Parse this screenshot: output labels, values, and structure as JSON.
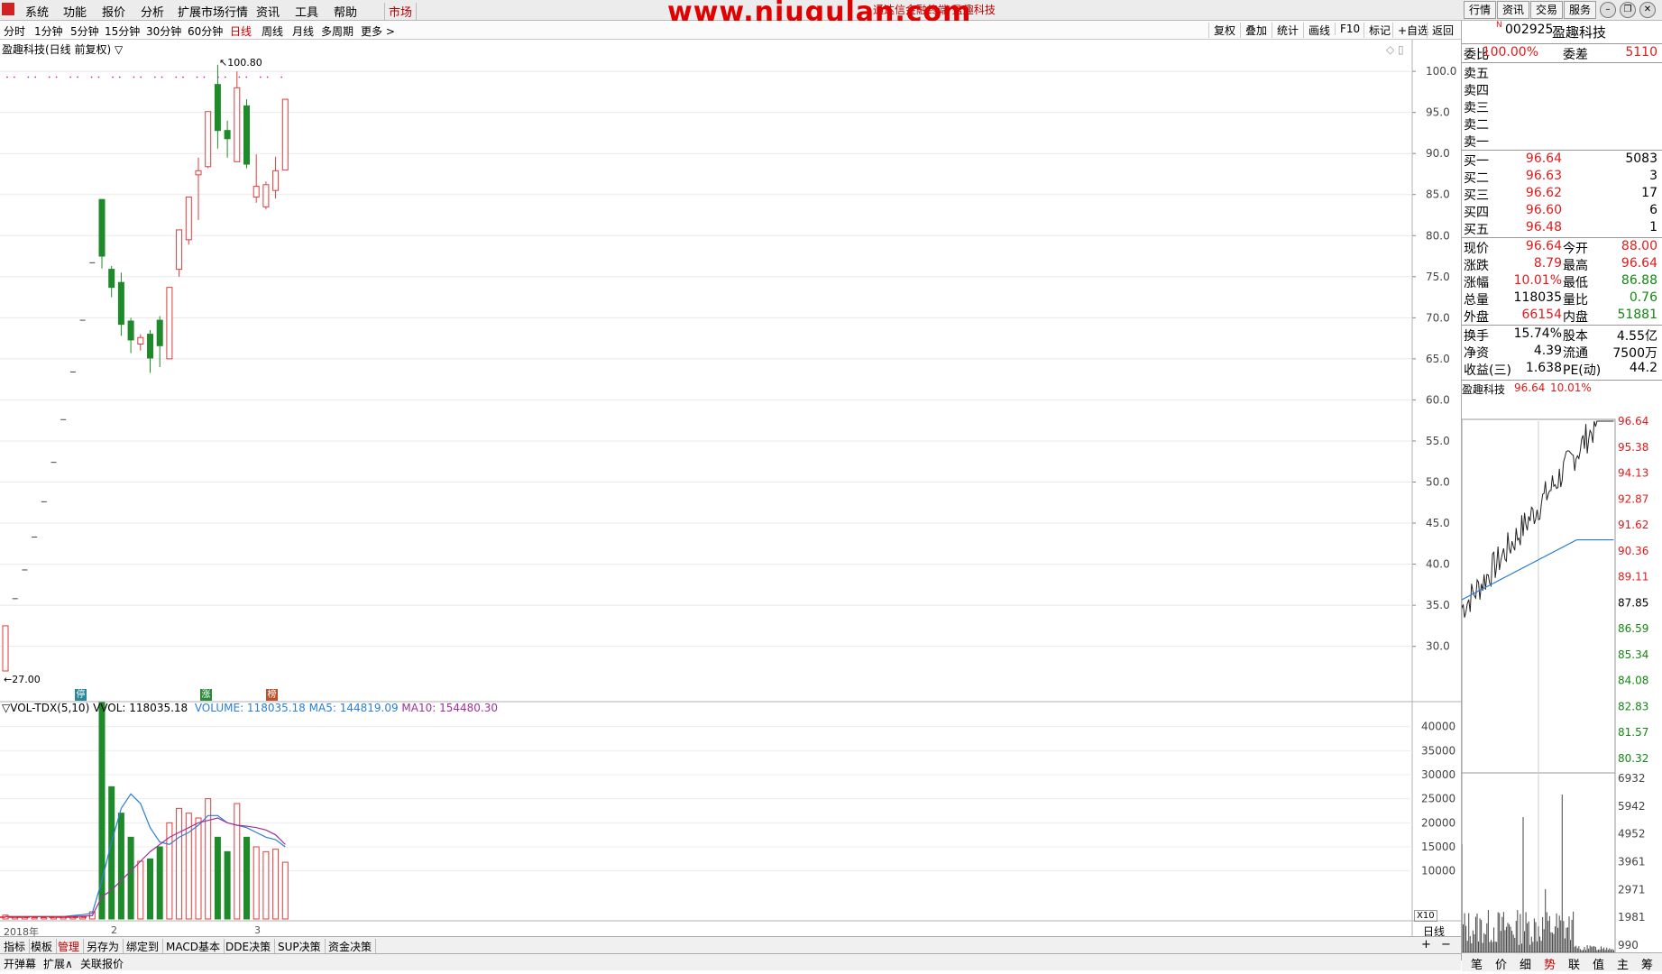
{
  "menu": {
    "items": [
      "系统",
      "功能",
      "报价",
      "分析",
      "扩展市场行情",
      "资讯",
      "工具",
      "帮助"
    ],
    "active": "市场",
    "watermark": "www.niugulan.com",
    "window_title": "通达信金融终端 盈趣科技",
    "right_buttons": [
      "行情",
      "资讯",
      "交易",
      "服务"
    ]
  },
  "periods": {
    "items": [
      "分时",
      "1分钟",
      "5分钟",
      "15分钟",
      "30分钟",
      "60分钟",
      "日线",
      "周线",
      "月线",
      "多周期",
      "更多 >"
    ],
    "active": "日线",
    "tools": [
      "复权",
      "叠加",
      "统计",
      "画线",
      "F10",
      "标记",
      "+自选",
      "返回"
    ]
  },
  "chart": {
    "title": "盈趣科技(日线 前复权) ▽",
    "high_label": "100.80",
    "low_label": "27.00",
    "markers": [
      "停",
      "涨",
      "榜"
    ],
    "x_labels": [
      "2018年",
      "2",
      "3"
    ],
    "period_label": "日线",
    "vol_title_prefix": "▽VOL-TDX(5,10)",
    "vol_value": "VVOL: 118035.18",
    "volume_label": "VOLUME: 118035.18",
    "ma5_label": "MA5: 144819.09",
    "ma10_label": "MA10: 154480.30",
    "x10": "X10"
  },
  "chart_data": {
    "type": "candlestick",
    "price_axis": {
      "ticks": [
        100.0,
        95.0,
        90.0,
        85.0,
        80.0,
        75.0,
        70.0,
        65.0,
        60.0,
        55.0,
        50.0,
        45.0,
        40.0,
        35.0,
        30.0
      ],
      "range": [
        27,
        101
      ]
    },
    "volume_axis": {
      "ticks": [
        40000,
        35000,
        30000,
        25000,
        20000,
        15000,
        10000
      ],
      "range": [
        0,
        45000
      ]
    },
    "candles": [
      {
        "o": 27.0,
        "h": 32.5,
        "l": 27.0,
        "c": 32.5,
        "v": 800
      },
      {
        "o": 35.8,
        "h": 35.8,
        "l": 35.8,
        "c": 35.8,
        "v": 300
      },
      {
        "o": 39.3,
        "h": 39.3,
        "l": 39.3,
        "c": 39.3,
        "v": 300
      },
      {
        "o": 43.3,
        "h": 43.3,
        "l": 43.3,
        "c": 43.3,
        "v": 300
      },
      {
        "o": 47.6,
        "h": 47.6,
        "l": 47.6,
        "c": 47.6,
        "v": 300
      },
      {
        "o": 52.4,
        "h": 52.4,
        "l": 52.4,
        "c": 52.4,
        "v": 300
      },
      {
        "o": 57.6,
        "h": 57.6,
        "l": 57.6,
        "c": 57.6,
        "v": 300
      },
      {
        "o": 63.4,
        "h": 63.4,
        "l": 63.4,
        "c": 63.4,
        "v": 300
      },
      {
        "o": 69.7,
        "h": 69.7,
        "l": 69.7,
        "c": 69.7,
        "v": 400
      },
      {
        "o": 76.7,
        "h": 76.7,
        "l": 76.7,
        "c": 76.7,
        "v": 1500
      },
      {
        "o": 84.4,
        "h": 84.4,
        "l": 76.0,
        "c": 77.5,
        "v": 45000
      },
      {
        "o": 75.9,
        "h": 76.3,
        "l": 72.5,
        "c": 73.7,
        "v": 27500
      },
      {
        "o": 74.3,
        "h": 75.5,
        "l": 67.8,
        "c": 69.2,
        "v": 22000
      },
      {
        "o": 69.6,
        "h": 70.0,
        "l": 65.7,
        "c": 67.3,
        "v": 17000
      },
      {
        "o": 66.8,
        "h": 68.0,
        "l": 66.0,
        "c": 67.6,
        "v": 12000
      },
      {
        "o": 68.0,
        "h": 68.5,
        "l": 63.3,
        "c": 65.1,
        "v": 12500
      },
      {
        "o": 69.7,
        "h": 70.2,
        "l": 64.0,
        "c": 66.6,
        "v": 15000
      },
      {
        "o": 65.0,
        "h": 73.7,
        "l": 65.0,
        "c": 73.7,
        "v": 20000
      },
      {
        "o": 75.9,
        "h": 80.7,
        "l": 75.0,
        "c": 80.7,
        "v": 23000
      },
      {
        "o": 79.5,
        "h": 84.7,
        "l": 78.9,
        "c": 84.7,
        "v": 22000
      },
      {
        "o": 87.4,
        "h": 89.5,
        "l": 81.9,
        "c": 87.9,
        "v": 21000
      },
      {
        "o": 88.4,
        "h": 95.1,
        "l": 88.2,
        "c": 95.1,
        "v": 25000
      },
      {
        "o": 98.4,
        "h": 100.8,
        "l": 90.6,
        "c": 92.8,
        "v": 17000
      },
      {
        "o": 92.8,
        "h": 94.0,
        "l": 89.5,
        "c": 91.8,
        "v": 14000
      },
      {
        "o": 89.0,
        "h": 100.0,
        "l": 89.0,
        "c": 98.0,
        "v": 24000
      },
      {
        "o": 95.8,
        "h": 96.6,
        "l": 88.2,
        "c": 88.7,
        "v": 17000
      },
      {
        "o": 84.7,
        "h": 89.9,
        "l": 84.0,
        "c": 86.0,
        "v": 15000
      },
      {
        "o": 83.5,
        "h": 86.6,
        "l": 83.2,
        "c": 86.2,
        "v": 14000
      },
      {
        "o": 85.5,
        "h": 89.6,
        "l": 84.5,
        "c": 87.9,
        "v": 14500
      },
      {
        "o": 88.0,
        "h": 96.6,
        "l": 88.0,
        "c": 96.6,
        "v": 11800
      }
    ],
    "ma5": [
      500,
      500,
      500,
      500,
      500,
      500,
      500,
      700,
      900,
      1200,
      8000,
      16000,
      23000,
      26000,
      24000,
      19000,
      16000,
      15500,
      17000,
      18000,
      19500,
      21500,
      21500,
      20000,
      19500,
      19000,
      18000,
      17000,
      16500,
      15000
    ],
    "ma10": [
      500,
      500,
      500,
      500,
      500,
      500,
      500,
      500,
      600,
      700,
      4600,
      6000,
      8000,
      10000,
      12000,
      14000,
      15500,
      17000,
      18000,
      19000,
      20000,
      20500,
      21000,
      20000,
      19500,
      19300,
      19000,
      18500,
      17500,
      15500
    ]
  },
  "quote": {
    "code": "002925",
    "name": "盈趣科技",
    "badge": "N",
    "weibi_label": "委比",
    "weibi": "100.00%",
    "weicha_label": "委差",
    "weicha": "5110",
    "sells": [
      {
        "label": "卖五",
        "price": "",
        "vol": ""
      },
      {
        "label": "卖四",
        "price": "",
        "vol": ""
      },
      {
        "label": "卖三",
        "price": "",
        "vol": ""
      },
      {
        "label": "卖二",
        "price": "",
        "vol": ""
      },
      {
        "label": "卖一",
        "price": "",
        "vol": ""
      }
    ],
    "buys": [
      {
        "label": "买一",
        "price": "96.64",
        "vol": "5083"
      },
      {
        "label": "买二",
        "price": "96.63",
        "vol": "3"
      },
      {
        "label": "买三",
        "price": "96.62",
        "vol": "17"
      },
      {
        "label": "买四",
        "price": "96.60",
        "vol": "6"
      },
      {
        "label": "买五",
        "price": "96.48",
        "vol": "1"
      }
    ],
    "stats": [
      {
        "l1": "现价",
        "v1": "96.64",
        "c1": "red",
        "l2": "今开",
        "v2": "88.00",
        "c2": "red"
      },
      {
        "l1": "涨跌",
        "v1": "8.79",
        "c1": "red",
        "l2": "最高",
        "v2": "96.64",
        "c2": "red"
      },
      {
        "l1": "涨幅",
        "v1": "10.01%",
        "c1": "red",
        "l2": "最低",
        "v2": "86.88",
        "c2": "green"
      },
      {
        "l1": "总量",
        "v1": "118035",
        "c1": "black",
        "l2": "量比",
        "v2": "0.76",
        "c2": "green"
      },
      {
        "l1": "外盘",
        "v1": "66154",
        "c1": "red",
        "l2": "内盘",
        "v2": "51881",
        "c2": "green"
      }
    ],
    "fund": [
      {
        "l1": "换手",
        "v1": "15.74%",
        "l2": "股本",
        "v2": "4.55亿"
      },
      {
        "l1": "净资",
        "v1": "4.39",
        "l2": "流通",
        "v2": "7500万"
      },
      {
        "l1": "收益(三)",
        "v1": "1.638",
        "l2": "PE(动)",
        "v2": "44.2"
      }
    ]
  },
  "mini": {
    "title": "盈趣科技",
    "price": "96.64",
    "pct": "10.01%",
    "price_ticks": [
      "96.64",
      "95.38",
      "94.13",
      "92.87",
      "91.62",
      "90.36",
      "89.11",
      "87.85",
      "86.59",
      "85.34",
      "84.08",
      "82.83",
      "81.57",
      "80.32"
    ],
    "vol_ticks": [
      "6932",
      "5942",
      "4952",
      "3961",
      "2971",
      "1981",
      "990"
    ]
  },
  "bottom_tabs": [
    "指标",
    "模板",
    "管理",
    "另存为",
    "绑定到",
    "MACD基本",
    "DDE决策",
    "SUP决策",
    "资金决策"
  ],
  "bottom_active": "管理",
  "status": [
    "开弹幕",
    "扩展∧",
    "关联报价"
  ],
  "right_tabs": [
    "笔",
    "价",
    "细",
    "势",
    "联",
    "值",
    "主",
    "筹"
  ],
  "right_tab_active": "势",
  "zoom": [
    "+",
    "−"
  ]
}
